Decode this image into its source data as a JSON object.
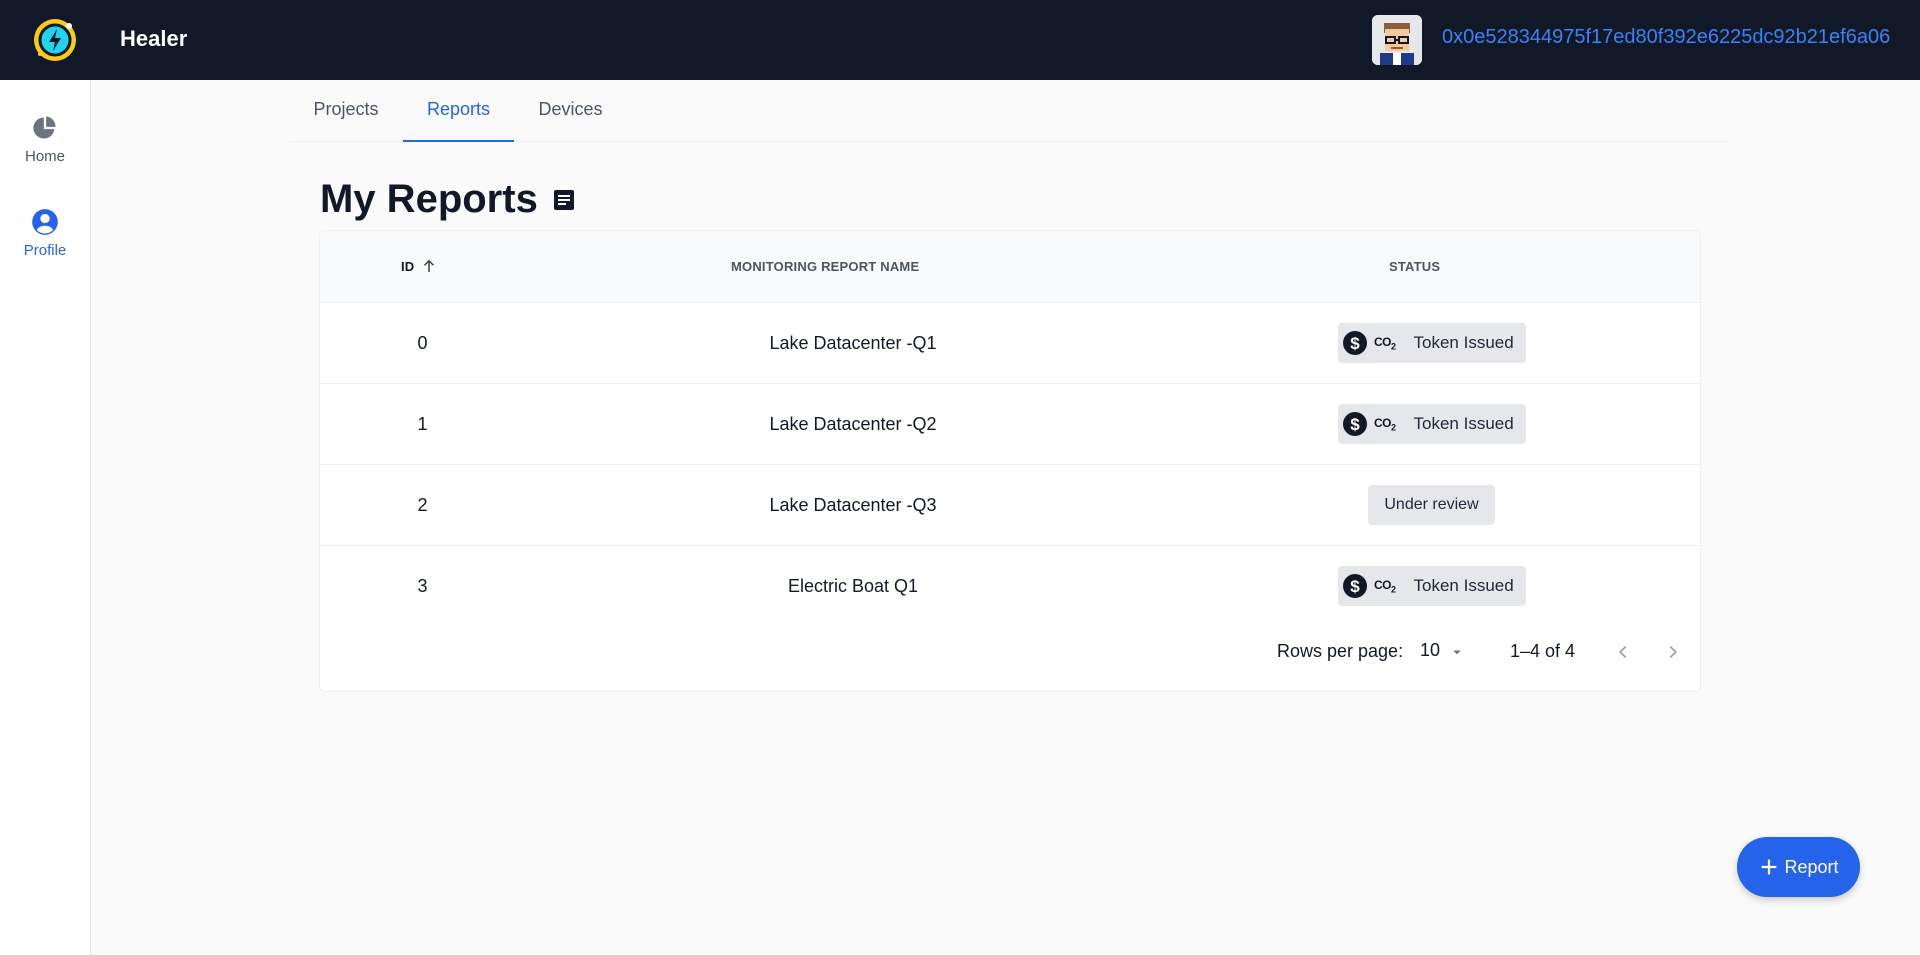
{
  "app": {
    "brand": "Healer",
    "wallet_address": "0x0e528344975f17ed80f392e6225dc92b21ef6a06",
    "logo_icon": "lightning-bolt-icon",
    "accent_color": "#2563eb",
    "header_bg": "#111827"
  },
  "sidebar": {
    "items": [
      {
        "label": "Home",
        "icon": "pie-chart-icon",
        "active": false
      },
      {
        "label": "Profile",
        "icon": "user-circle-icon",
        "active": true
      }
    ]
  },
  "tabs": [
    {
      "label": "Projects",
      "active": false
    },
    {
      "label": "Reports",
      "active": true
    },
    {
      "label": "Devices",
      "active": false
    }
  ],
  "page": {
    "title": "My Reports",
    "title_icon": "document-icon"
  },
  "table": {
    "columns": {
      "id": "ID",
      "name": "MONITORING REPORT NAME",
      "status": "STATUS"
    },
    "sort": {
      "column": "ID",
      "direction": "ascending"
    },
    "rows": [
      {
        "id": "0",
        "name": "Lake Datacenter -Q1",
        "status": "Token Issued",
        "co2_label": "CO",
        "co2_sub": "2"
      },
      {
        "id": "1",
        "name": "Lake Datacenter -Q2",
        "status": "Token Issued",
        "co2_label": "CO",
        "co2_sub": "2"
      },
      {
        "id": "2",
        "name": "Lake Datacenter -Q3",
        "status": "Under review"
      },
      {
        "id": "3",
        "name": "Electric Boat Q1",
        "status": "Token Issued",
        "co2_label": "CO",
        "co2_sub": "2"
      }
    ]
  },
  "pagination": {
    "rows_per_page_label": "Rows per page:",
    "rows_per_page": "10",
    "range": "1–4 of 4"
  },
  "fab": {
    "label": "Report",
    "icon": "plus-icon"
  }
}
